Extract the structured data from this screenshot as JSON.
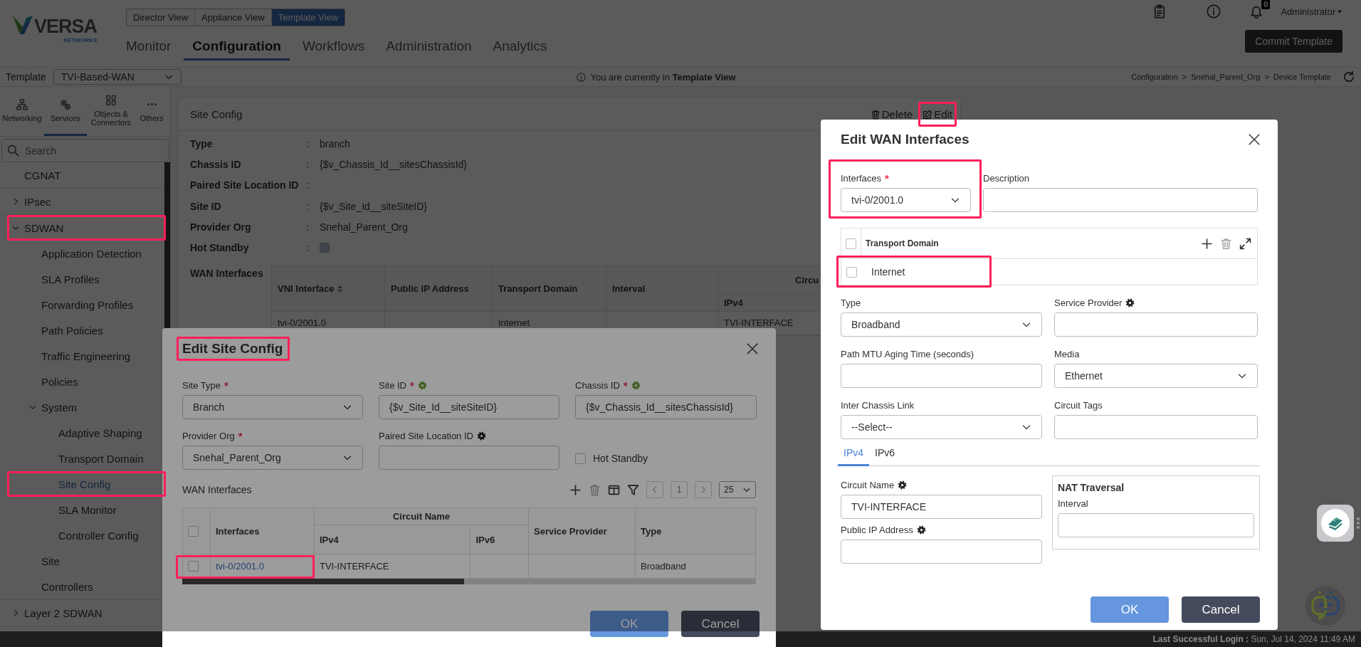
{
  "header": {
    "logo": {
      "name": "VERSA",
      "tagline": "NETWORKS"
    },
    "views": [
      {
        "label": "Director View",
        "selected": false
      },
      {
        "label": "Appliance View",
        "selected": false
      },
      {
        "label": "Template View",
        "selected": true
      }
    ],
    "nav": [
      {
        "label": "Monitor",
        "selected": false
      },
      {
        "label": "Configuration",
        "selected": true
      },
      {
        "label": "Workflows",
        "selected": false
      },
      {
        "label": "Administration",
        "selected": false
      },
      {
        "label": "Analytics",
        "selected": false
      }
    ],
    "notification_count": "0",
    "user": "Administrator",
    "commit_button": "Commit Template"
  },
  "template_bar": {
    "label": "Template",
    "value": "TVI-Based-WAN",
    "notice": "You are currently in **Template View**",
    "breadcrumb": [
      {
        "label": "Configuration",
        "separator": ">"
      },
      {
        "label": "Snehal_Parent_Org",
        "separator": ">"
      },
      {
        "label": "Device Template"
      }
    ]
  },
  "sidebar": {
    "tabs": [
      {
        "label": "Networking",
        "selected": false
      },
      {
        "label": "Services",
        "selected": true
      },
      {
        "label": "Objects & Connectors",
        "selected": false
      },
      {
        "label": "Others",
        "selected": false
      }
    ],
    "search": {
      "placeholder": "Search"
    },
    "items": [
      {
        "label": "CGNAT",
        "selected": false
      },
      {
        "label": "IPsec",
        "expanded": false,
        "selected": false
      },
      {
        "label": "SDWAN",
        "expanded": true,
        "selected": false,
        "highlighted": true,
        "children": [
          {
            "label": "Application Detection",
            "selected": false
          },
          {
            "label": "SLA Profiles",
            "selected": false
          },
          {
            "label": "Forwarding Profiles",
            "selected": false
          },
          {
            "label": "Path Policies",
            "selected": false
          },
          {
            "label": "Traffic Engineering",
            "selected": false
          },
          {
            "label": "Policies",
            "selected": false
          },
          {
            "label": "System",
            "expanded": true,
            "selected": false,
            "children": [
              {
                "label": "Adaptive Shaping",
                "selected": false
              },
              {
                "label": "Transport Domain",
                "selected": false
              },
              {
                "label": "Site Config",
                "selected": true,
                "highlighted": true
              },
              {
                "label": "SLA Monitor",
                "selected": false
              },
              {
                "label": "Controller Config",
                "selected": false
              }
            ]
          },
          {
            "label": "Site",
            "selected": false
          },
          {
            "label": "Controllers",
            "selected": false
          }
        ]
      },
      {
        "label": "Layer 2 SDWAN",
        "expanded": false,
        "selected": false
      }
    ]
  },
  "site_config": {
    "title": "Site Config",
    "actions": [
      {
        "label": "Delete",
        "highlighted": false
      },
      {
        "label": "Edit",
        "highlighted": true
      }
    ],
    "fields": [
      {
        "label": "Type",
        "separator": ":",
        "value": "branch"
      },
      {
        "label": "Chassis ID",
        "separator": ":",
        "value": "{$v_Chassis_Id__sitesChassisId}"
      },
      {
        "label": "Paired Site Location ID",
        "separator": ":"
      },
      {
        "label": "Site ID",
        "separator": ":",
        "value": "{$v_Site_Id__siteSiteID}"
      },
      {
        "label": "Provider Org",
        "separator": ":",
        "value": "Snehal_Parent_Org"
      },
      {
        "label": "Hot Standby",
        "separator": ":",
        "kind": "checkbox",
        "checked": false
      }
    ],
    "wan_interfaces": {
      "label": "WAN Interfaces",
      "columns": [
        {
          "label": "VNI Interface",
          "sortable": true
        },
        {
          "label": "Public IP Address"
        },
        {
          "label": "Transport Domain"
        },
        {
          "label": "Interval"
        },
        {
          "label": "Circu",
          "sub": [
            "IPv4"
          ]
        }
      ],
      "rows": [
        {
          "cells": [
            "tvi-0/2001.0",
            null,
            "Internet",
            null,
            "TVI-INTERFACE"
          ]
        }
      ]
    }
  },
  "edit_site_config": {
    "title": "Edit Site Config",
    "highlighted": true,
    "fields": [
      {
        "label": "Site Type",
        "required_mark": "*",
        "kind": "select",
        "value": "Branch"
      },
      {
        "label": "Site ID",
        "required_mark": "*",
        "gear": {
          "color": "#415e23"
        },
        "kind": "input",
        "value": "{$v_Site_Id__siteSiteID}"
      },
      {
        "label": "Chassis ID",
        "required_mark": "*",
        "gear": {
          "color": "#415e23"
        },
        "kind": "input",
        "value": "{$v_Chassis_Id__sitesChassisId}"
      },
      {
        "label": "Provider Org",
        "required_mark": "*",
        "kind": "select",
        "value": "Snehal_Parent_Org"
      },
      {
        "label": "Paired Site Location ID",
        "gear": {
          "color": "#151515"
        },
        "kind": "input"
      },
      {
        "label": "Hot Standby",
        "kind": "checkbox",
        "checked": false
      }
    ],
    "wan_interfaces": {
      "label": "WAN Interfaces",
      "page": "1",
      "page_size": "25",
      "columns": [
        {
          "label": "Interfaces"
        },
        {
          "label": "Circuit Name",
          "sub": [
            "IPv4",
            "IPv6"
          ]
        },
        {
          "label": "Service Provider"
        },
        {
          "label": "Type"
        }
      ],
      "header_checked": false,
      "rows": [
        {
          "checked": false,
          "highlighted": true,
          "cells": [
            {
              "text": "tvi-0/2001.0",
              "kind": "link"
            },
            {
              "text": "TVI-INTERFACE"
            },
            null,
            null,
            {
              "text": "Broadband"
            }
          ]
        }
      ]
    },
    "buttons": [
      {
        "label": "OK",
        "kind": "primary"
      },
      {
        "label": "Cancel",
        "kind": "secondary"
      }
    ]
  },
  "edit_wan_interfaces": {
    "title": "Edit WAN Interfaces",
    "top_fields": [
      {
        "label": "Interfaces",
        "required_mark": "*",
        "kind": "select",
        "value": "tvi-0/2001.0",
        "highlighted": true
      },
      {
        "label": "Description",
        "kind": "input"
      }
    ],
    "transport_domain": {
      "column": "Transport Domain",
      "header_checked": false,
      "rows": [
        {
          "label": "Internet",
          "checked": false,
          "highlighted": true
        }
      ]
    },
    "fields": [
      {
        "label": "Type",
        "kind": "select",
        "value": "Broadband"
      },
      {
        "label": "Service Provider",
        "gear": {
          "color": "#222222"
        },
        "kind": "input"
      },
      {
        "label": "Path MTU Aging Time (seconds)",
        "kind": "input"
      },
      {
        "label": "Media",
        "kind": "select",
        "value": "Ethernet"
      },
      {
        "label": "Inter Chassis Link",
        "kind": "select",
        "value": "--Select--"
      },
      {
        "label": "Circuit Tags",
        "kind": "input"
      }
    ],
    "tabs": [
      {
        "label": "IPv4",
        "selected": true
      },
      {
        "label": "IPv6",
        "selected": false
      }
    ],
    "circuit_fields": [
      {
        "label": "Circuit Name",
        "gear": {
          "color": "#222222"
        },
        "kind": "input",
        "value": "TVI-INTERFACE"
      },
      {
        "label": "Public IP Address",
        "gear": {
          "color": "#222222"
        },
        "kind": "input"
      }
    ],
    "nat_traversal": {
      "title": "NAT Traversal",
      "fields": [
        {
          "label": "Interval",
          "kind": "input"
        }
      ]
    },
    "buttons": [
      {
        "label": "OK",
        "kind": "primary"
      },
      {
        "label": "Cancel",
        "kind": "secondary"
      }
    ]
  },
  "status_bar": {
    "text": "**Last Successful Login :** Sun, Jul 14, 2024 11:49 AM"
  }
}
